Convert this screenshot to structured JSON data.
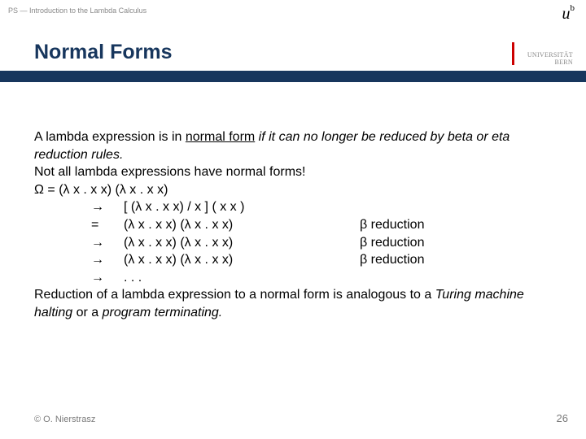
{
  "header": {
    "breadcrumb": "PS — Introduction to the Lambda Calculus"
  },
  "logo": {
    "mark": "u",
    "exp": "b",
    "line1": "UNIVERSITÄT",
    "line2": "BERN"
  },
  "title": "Normal Forms",
  "body": {
    "p1_a": "A lambda expression is in ",
    "p1_b": "normal form",
    "p1_c": " if it can no longer be reduced by beta or eta reduction rules.",
    "p2": "Not all lambda expressions have normal forms!",
    "omega": "Ω = (λ x . x x) (λ x . x x)",
    "rows": [
      {
        "arrow": "→",
        "expr": "[ (λ x . x x) / x ] ( x x )",
        "note": ""
      },
      {
        "arrow": "=",
        "expr": "(λ x . x x) (λ x . x x)",
        "note": "β reduction"
      },
      {
        "arrow": "→",
        "expr": "(λ x . x x) (λ x . x x)",
        "note": "β reduction"
      },
      {
        "arrow": "→",
        "expr": "(λ x . x x) (λ x . x x)",
        "note": "β reduction"
      },
      {
        "arrow": "→",
        "expr": ". . .",
        "note": ""
      }
    ],
    "p3_a": "Reduction of a lambda expression to a normal form is analogous to a ",
    "p3_b": "Turing machine halting",
    "p3_c": " or a ",
    "p3_d": "program terminating.",
    "p3_e": ""
  },
  "footer": {
    "copyright": "© O. Nierstrasz",
    "page": "26"
  }
}
